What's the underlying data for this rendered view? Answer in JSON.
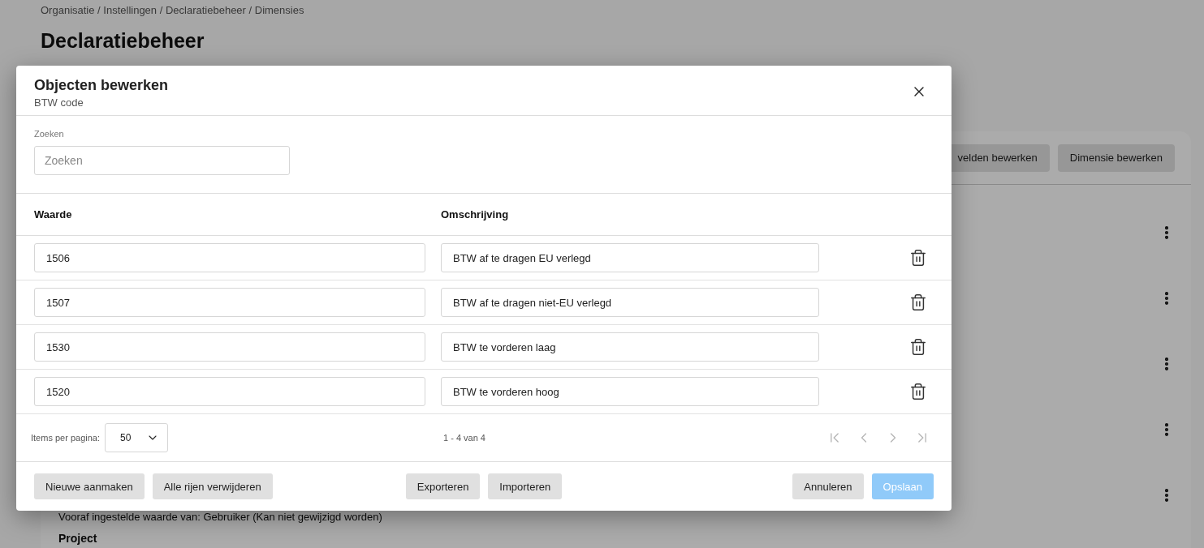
{
  "page": {
    "breadcrumb": "Organisatie / Instellingen / Declaratiebeheer / Dimensies",
    "title": "Declaratiebeheer",
    "card": {
      "buttons": [
        "velden bewerken",
        "Dimensie bewerken"
      ],
      "rows": [
        {
          "kind": "menu"
        },
        {
          "kind": "menu"
        },
        {
          "kind": "menu"
        },
        {
          "kind": "menu"
        },
        {
          "kind": "menu",
          "note": "Vooraf ingestelde waarde van: Gebruiker (Kan niet gewijzigd worden)"
        }
      ],
      "section_title": "Project"
    }
  },
  "dialog": {
    "title": "Objecten bewerken",
    "subtitle": "BTW code",
    "search": {
      "label": "Zoeken",
      "placeholder": "Zoeken"
    },
    "columns": [
      "Waarde",
      "Omschrijving"
    ],
    "rows": [
      {
        "value": "1506",
        "description": "BTW af te dragen EU verlegd"
      },
      {
        "value": "1507",
        "description": "BTW af te dragen niet-EU verlegd"
      },
      {
        "value": "1530",
        "description": "BTW te vorderen laag"
      },
      {
        "value": "1520",
        "description": "BTW te vorderen hoog"
      }
    ],
    "pagination": {
      "label": "Items per pagina:",
      "page_size": "50",
      "range": "1 - 4 van 4",
      "buttons": [
        {
          "kind": "first",
          "disabled": true
        },
        {
          "kind": "previous",
          "disabled": true
        },
        {
          "kind": "next",
          "disabled": true
        },
        {
          "kind": "last",
          "disabled": true
        }
      ]
    },
    "action_groups": [
      [
        {
          "label": "Nieuwe aanmaken",
          "kind": "secondary",
          "disabled": false
        },
        {
          "label": "Alle rijen verwijderen",
          "kind": "secondary",
          "disabled": false
        }
      ],
      [
        {
          "label": "Exporteren",
          "kind": "secondary",
          "disabled": false
        },
        {
          "label": "Importeren",
          "kind": "secondary",
          "disabled": false
        }
      ],
      [
        {
          "label": "Annuleren",
          "kind": "secondary",
          "disabled": false
        },
        {
          "label": "Opslaan",
          "kind": "primary",
          "disabled": true
        }
      ]
    ]
  }
}
